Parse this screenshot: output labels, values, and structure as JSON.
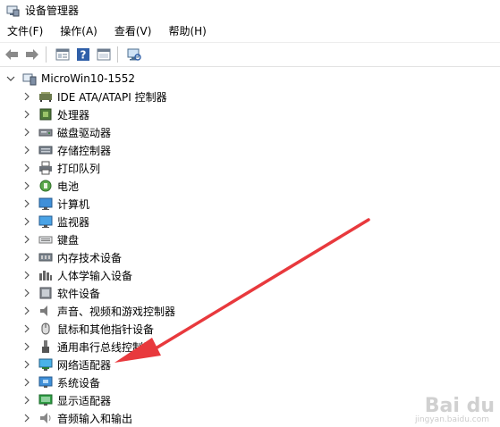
{
  "window": {
    "title": "设备管理器"
  },
  "menu": [
    "文件(F)",
    "操作(A)",
    "查看(V)",
    "帮助(H)"
  ],
  "toolbar": {
    "buttons": [
      "back-icon",
      "forward-icon",
      "properties-window-icon",
      "help-icon",
      "details-window-icon",
      "monitor-scan-icon"
    ]
  },
  "tree": {
    "root": "MicroWin10-1552",
    "items": [
      {
        "label": "IDE ATA/ATAPI 控制器",
        "icon": "ide-controller-icon"
      },
      {
        "label": "处理器",
        "icon": "processor-icon"
      },
      {
        "label": "磁盘驱动器",
        "icon": "disk-drive-icon"
      },
      {
        "label": "存储控制器",
        "icon": "storage-controller-icon"
      },
      {
        "label": "打印队列",
        "icon": "printer-icon"
      },
      {
        "label": "电池",
        "icon": "battery-icon"
      },
      {
        "label": "计算机",
        "icon": "computer-icon"
      },
      {
        "label": "监视器",
        "icon": "monitor-icon"
      },
      {
        "label": "键盘",
        "icon": "keyboard-icon"
      },
      {
        "label": "内存技术设备",
        "icon": "memory-icon"
      },
      {
        "label": "人体学输入设备",
        "icon": "hid-icon"
      },
      {
        "label": "软件设备",
        "icon": "software-device-icon"
      },
      {
        "label": "声音、视频和游戏控制器",
        "icon": "sound-icon"
      },
      {
        "label": "鼠标和其他指针设备",
        "icon": "mouse-icon"
      },
      {
        "label": "通用串行总线控制器",
        "icon": "usb-icon"
      },
      {
        "label": "网络适配器",
        "icon": "network-adapter-icon"
      },
      {
        "label": "系统设备",
        "icon": "system-device-icon"
      },
      {
        "label": "显示适配器",
        "icon": "display-adapter-icon"
      },
      {
        "label": "音频输入和输出",
        "icon": "audio-io-icon"
      }
    ]
  },
  "annotation": {
    "color": "#e8393d"
  },
  "watermark": {
    "text": "Bai du",
    "sub": "jingyan.baidu.com"
  }
}
